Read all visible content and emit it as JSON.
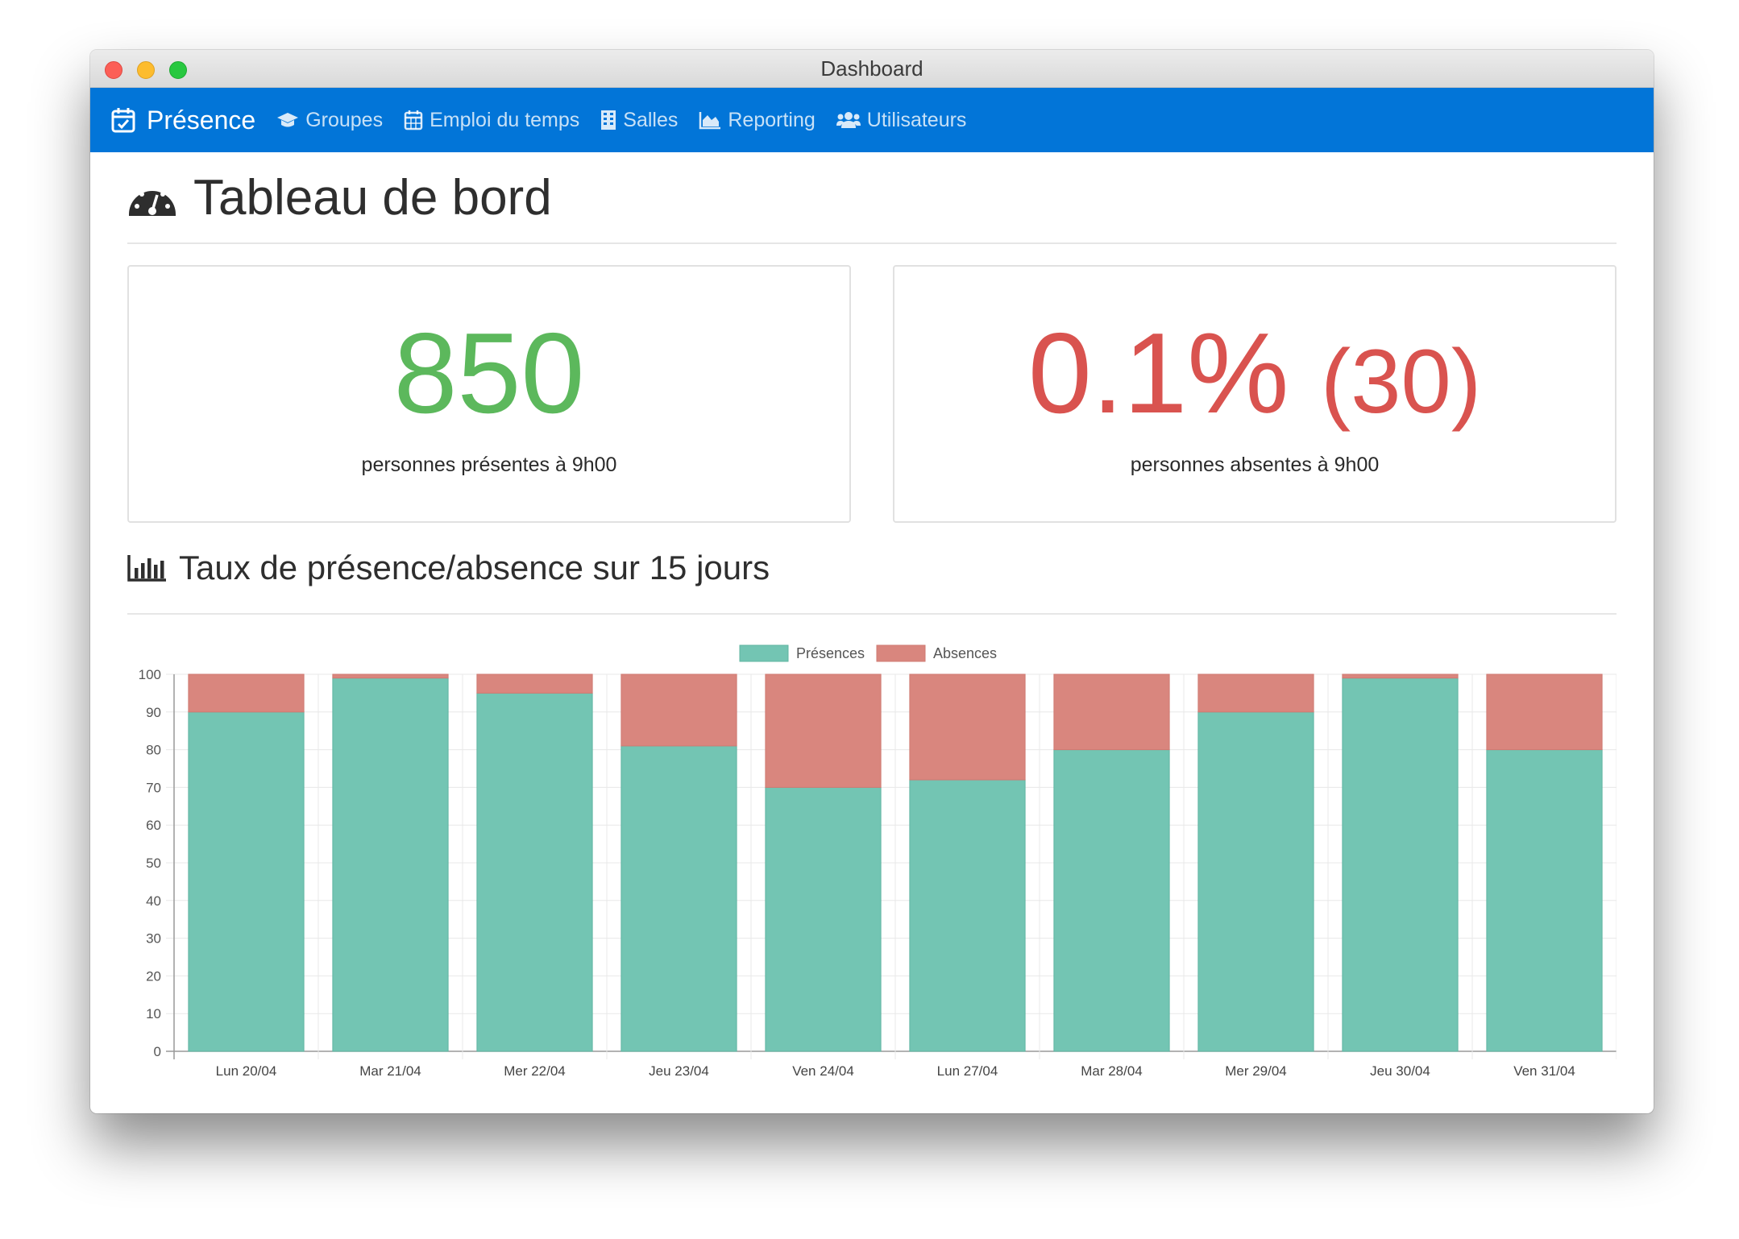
{
  "window": {
    "title": "Dashboard"
  },
  "navbar": {
    "brand": "Présence",
    "items": [
      {
        "label": "Groupes",
        "icon": "graduation-cap-icon"
      },
      {
        "label": "Emploi du temps",
        "icon": "calendar-icon"
      },
      {
        "label": "Salles",
        "icon": "building-icon"
      },
      {
        "label": "Reporting",
        "icon": "area-chart-icon"
      },
      {
        "label": "Utilisateurs",
        "icon": "users-icon"
      }
    ]
  },
  "page": {
    "title": "Tableau de bord"
  },
  "stats": {
    "present_value": "850",
    "present_caption": "personnes présentes à 9h00",
    "absent_percent": "0.1%",
    "absent_count": "(30)",
    "absent_caption": "personnes absentes à 9h00"
  },
  "section": {
    "title": "Taux de présence/absence sur 15 jours"
  },
  "colors": {
    "presence": "#73c5b3",
    "absence": "#d9867e",
    "nav": "#0275d8",
    "green": "#5cb85c",
    "red": "#d9534f"
  },
  "chart_data": {
    "type": "bar",
    "stacked": true,
    "categories": [
      "Lun 20/04",
      "Mar 21/04",
      "Mer 22/04",
      "Jeu 23/04",
      "Ven 24/04",
      "Lun 27/04",
      "Mar 28/04",
      "Mer 29/04",
      "Jeu 30/04",
      "Ven 31/04"
    ],
    "series": [
      {
        "name": "Présences",
        "values": [
          90,
          99,
          95,
          81,
          70,
          72,
          80,
          90,
          99,
          80
        ]
      },
      {
        "name": "Absences",
        "values": [
          10,
          1,
          5,
          19,
          30,
          28,
          20,
          10,
          1,
          20
        ]
      }
    ],
    "ylim": [
      0,
      100
    ],
    "yticks": [
      0,
      10,
      20,
      30,
      40,
      50,
      60,
      70,
      80,
      90,
      100
    ],
    "grid": true,
    "legend_position": "top"
  }
}
